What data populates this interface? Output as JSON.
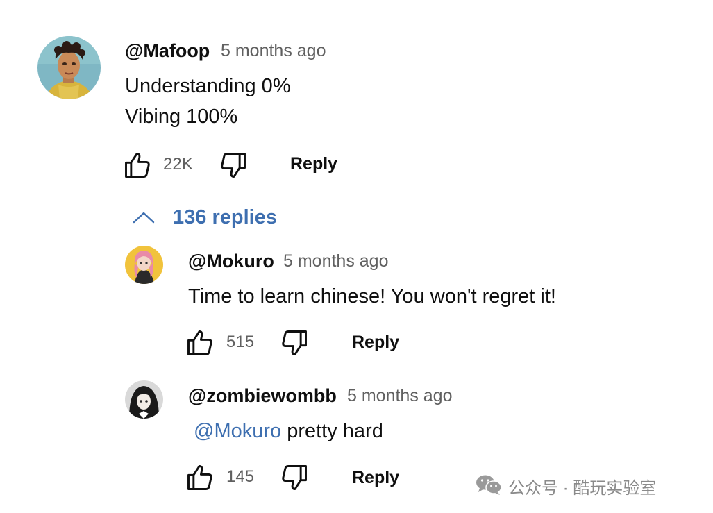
{
  "comment": {
    "author": "@Mafoop",
    "time": "5 months ago",
    "lines": [
      "Understanding 0%",
      "Vibing 100%"
    ],
    "likes": "22K",
    "reply_label": "Reply"
  },
  "replies_toggle": {
    "label": "136 replies"
  },
  "replies": [
    {
      "author": "@Mokuro",
      "time": "5 months ago",
      "text": "Time to learn chinese! You won't regret it!",
      "likes": "515",
      "reply_label": "Reply"
    },
    {
      "author": "@zombiewombb",
      "time": "5 months ago",
      "mention": "@Mokuro",
      "text": " pretty hard",
      "likes": "145",
      "reply_label": "Reply"
    }
  ],
  "watermark": {
    "text": "公众号 · 酷玩实验室",
    "icon": "wechat-icon"
  },
  "icons": {
    "like": "thumbs-up-icon",
    "dislike": "thumbs-down-icon",
    "collapse": "chevron-up-icon"
  },
  "colors": {
    "link": "#3e6fb0",
    "secondary_text": "#606060"
  }
}
